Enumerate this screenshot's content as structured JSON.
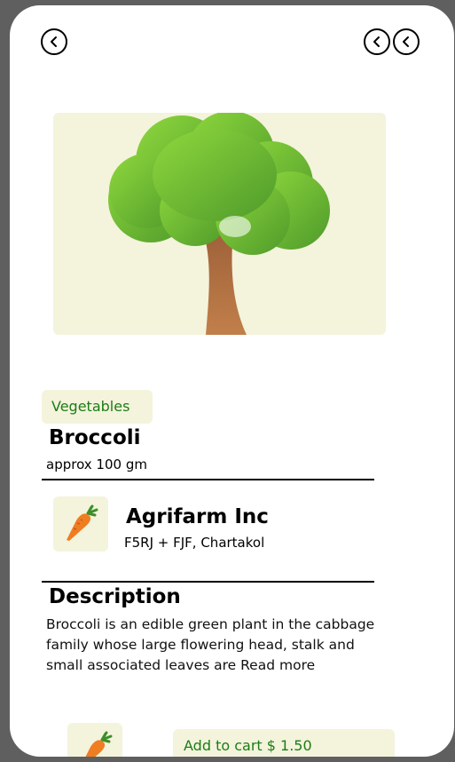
{
  "header": {
    "back_icon": "chevron-left-icon",
    "action_icons": [
      "chevron-left-icon",
      "chevron-left-icon"
    ]
  },
  "product": {
    "category": "Vegetables",
    "name": "Broccoli",
    "quantity": "approx 100 gm",
    "image_icon": "tree-icon"
  },
  "seller": {
    "name": "Agrifarm Inc",
    "address": "F5RJ + FJF, Chartakol",
    "logo_icon": "carrot-icon"
  },
  "description": {
    "title": "Description",
    "text": "Broccoli is an edible green plant in the cabbage family whose large flowering head, stalk and small associated leaves are",
    "read_more": "Read more"
  },
  "cart": {
    "thumb_icon": "carrot-icon",
    "button_label": "Add to cart $ 1.50"
  },
  "colors": {
    "accent_green": "#1c7d15",
    "card_bg": "#f4f3dc",
    "frame_bg": "#5f5f5f"
  }
}
